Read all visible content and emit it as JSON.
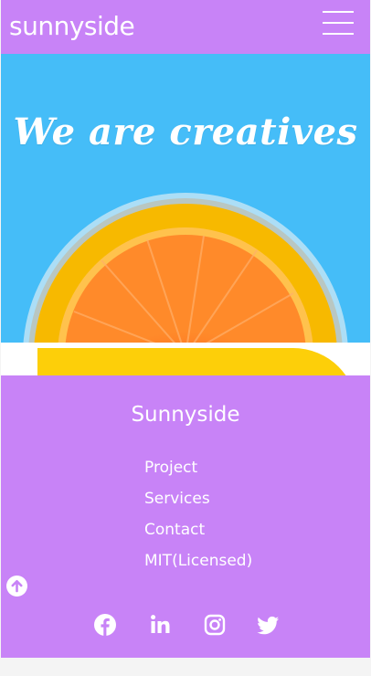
{
  "header": {
    "logo": "sunnyside",
    "menu_icon": "hamburger-menu-icon"
  },
  "hero": {
    "heading": "We are creatives",
    "image": "halved-orange-in-glass"
  },
  "footer": {
    "title": "Sunnyside",
    "links": [
      "Project",
      "Services",
      "Contact",
      "MIT(Licensed)"
    ],
    "scroll_top_icon": "arrow-up-circle-icon",
    "socials": [
      "facebook-icon",
      "linkedin-icon",
      "instagram-icon",
      "twitter-icon"
    ]
  },
  "colors": {
    "header_bg": "#c883f7",
    "hero_bg": "#45bdf8",
    "accent_yellow": "#fdcf09",
    "orange": "#ff6a1c",
    "page_bg": "#f4f4f4"
  }
}
